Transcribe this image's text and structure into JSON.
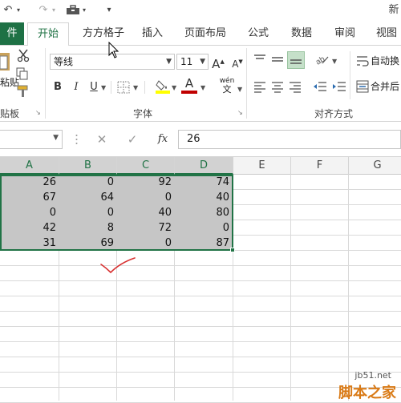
{
  "quick_access": {
    "undo_icon": "↶",
    "redo_icon": "↷",
    "customize_icon": "▾",
    "title_fragment": "新"
  },
  "tabs": [
    "件",
    "开始",
    "方方格子",
    "插入",
    "页面布局",
    "公式",
    "数据",
    "审阅",
    "视图"
  ],
  "ribbon": {
    "clipboard": {
      "paste_label": "粘贴",
      "group_label": "贴板"
    },
    "font": {
      "font_name": "等线",
      "font_size": "11",
      "bold": "B",
      "italic": "I",
      "underline": "U",
      "grow": "A",
      "shrink": "A",
      "font_color_letter": "A",
      "wen_top": "wén",
      "wen_bottom": "文",
      "group_label": "字体"
    },
    "alignment": {
      "wrap_text": "自动换",
      "merge_center": "合并后",
      "group_label": "对齐方式"
    },
    "colors": {
      "fill": "#ffff00",
      "font": "#c00000",
      "accent": "#217346"
    }
  },
  "formula_bar": {
    "fx": "fx",
    "value": "26",
    "cancel": "✕",
    "enter": "✓"
  },
  "columns": [
    "A",
    "B",
    "C",
    "D",
    "E",
    "F",
    "G"
  ],
  "selected_columns": [
    "A",
    "B",
    "C",
    "D"
  ],
  "cells": [
    [
      26,
      0,
      92,
      74
    ],
    [
      67,
      64,
      0,
      40
    ],
    [
      0,
      0,
      40,
      80
    ],
    [
      42,
      8,
      72,
      0
    ],
    [
      31,
      69,
      0,
      87
    ]
  ],
  "watermark": {
    "line1": "jb51.net",
    "line2": "脚本之家"
  }
}
